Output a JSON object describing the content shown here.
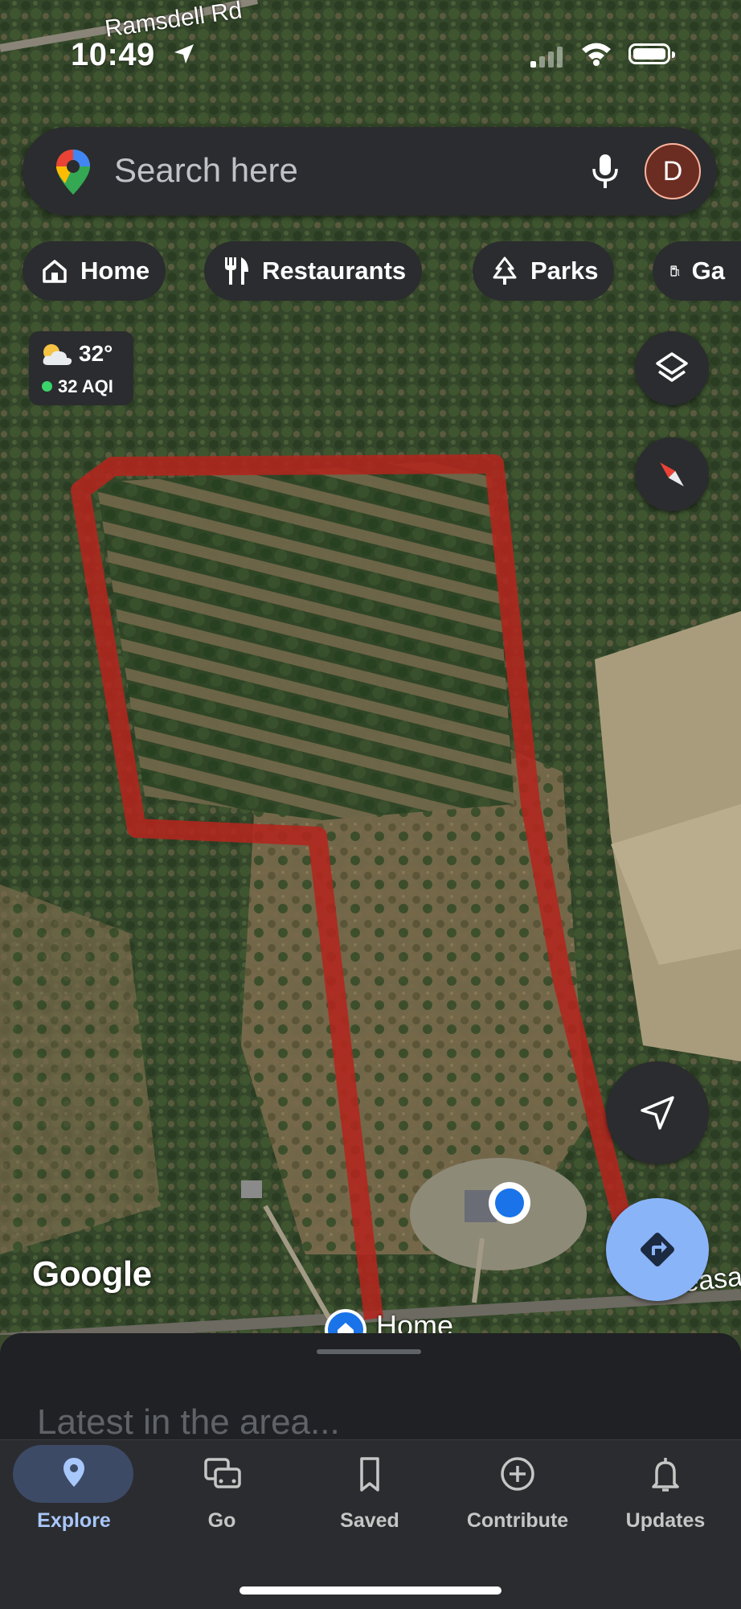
{
  "status_bar": {
    "time": "10:49"
  },
  "map": {
    "road_labels": [
      "Ramsdell Rd",
      "Pleasa"
    ],
    "home_label": "Home",
    "attribution": "Google"
  },
  "search": {
    "placeholder": "Search here",
    "avatar_initial": "D"
  },
  "chips": [
    {
      "label": "Home",
      "icon": "home-icon"
    },
    {
      "label": "Restaurants",
      "icon": "fork-knife-icon"
    },
    {
      "label": "Parks",
      "icon": "tree-icon"
    },
    {
      "label": "Ga",
      "icon": "gas-pump-icon"
    }
  ],
  "weather": {
    "temp": "32°",
    "aqi": "32 AQI"
  },
  "colors": {
    "route": "#b3261e",
    "accent": "#8ab4f8",
    "location": "#1a73e8",
    "panel": "#2b2c2f"
  },
  "sheet": {
    "title": "Latest in the area..."
  },
  "bottom_nav": {
    "active": "Explore",
    "items": [
      {
        "label": "Explore",
        "icon": "location-pin-icon"
      },
      {
        "label": "Go",
        "icon": "commute-icon"
      },
      {
        "label": "Saved",
        "icon": "bookmark-icon"
      },
      {
        "label": "Contribute",
        "icon": "add-circle-icon"
      },
      {
        "label": "Updates",
        "icon": "bell-icon"
      }
    ]
  }
}
